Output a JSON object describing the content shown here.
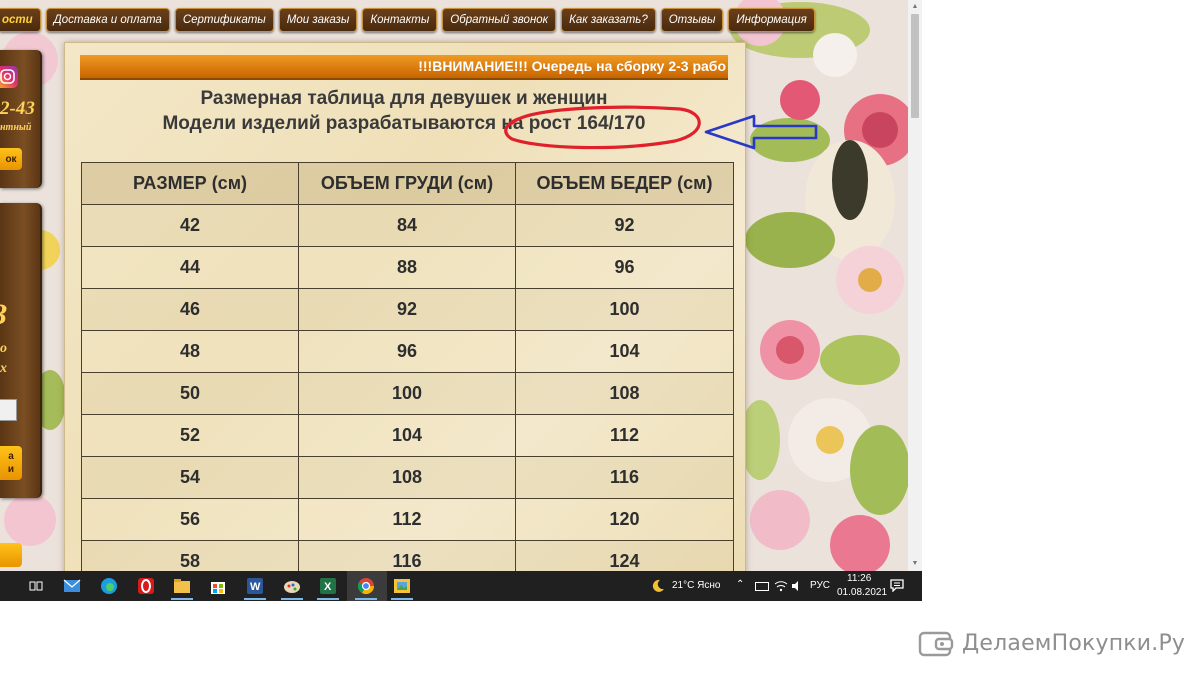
{
  "nav": {
    "items": [
      "ости",
      "Доставка и оплата",
      "Сертификаты",
      "Мои заказы",
      "Контакты",
      "Обратный звонок",
      "Как заказать?",
      "Отзывы",
      "Информация"
    ]
  },
  "sidebar": {
    "phone_fragment": "2-43",
    "phone_sub_fragment": "нтный",
    "button1_fragment": "ок",
    "script_letter": "З",
    "script_sub1": "о",
    "script_sub2": "х",
    "button2_line1": "а",
    "button2_line2": "и"
  },
  "notice": {
    "text": "!!!ВНИМАНИЕ!!! Очередь на сборку 2-3 рабо"
  },
  "title": {
    "line1": "Размерная таблица для девушек и женщин",
    "line2": "Модели изделий разрабатываются на рост 164/170"
  },
  "table": {
    "headers": [
      "РАЗМЕР (см)",
      "ОБЪЕМ  ГРУДИ (см)",
      "ОБЪЕМ БЕДЕР (см)"
    ],
    "rows": [
      [
        "42",
        "84",
        "92"
      ],
      [
        "44",
        "88",
        "96"
      ],
      [
        "46",
        "92",
        "100"
      ],
      [
        "48",
        "96",
        "104"
      ],
      [
        "50",
        "100",
        "108"
      ],
      [
        "52",
        "104",
        "112"
      ],
      [
        "54",
        "108",
        "116"
      ],
      [
        "56",
        "112",
        "120"
      ],
      [
        "58",
        "116",
        "124"
      ]
    ]
  },
  "taskbar": {
    "weather": "21°C  Ясно",
    "language": "РУС",
    "time": "11:26",
    "date": "01.08.2021"
  },
  "watermark": {
    "text": "ДелаемПокупки.Ру"
  },
  "colors": {
    "nav_bg": "#5a3414",
    "nav_border": "#c89038",
    "notice_orange": "#e07f10",
    "annotation_red": "#e0202a",
    "annotation_blue": "#2838c8",
    "taskbar": "#202020"
  }
}
